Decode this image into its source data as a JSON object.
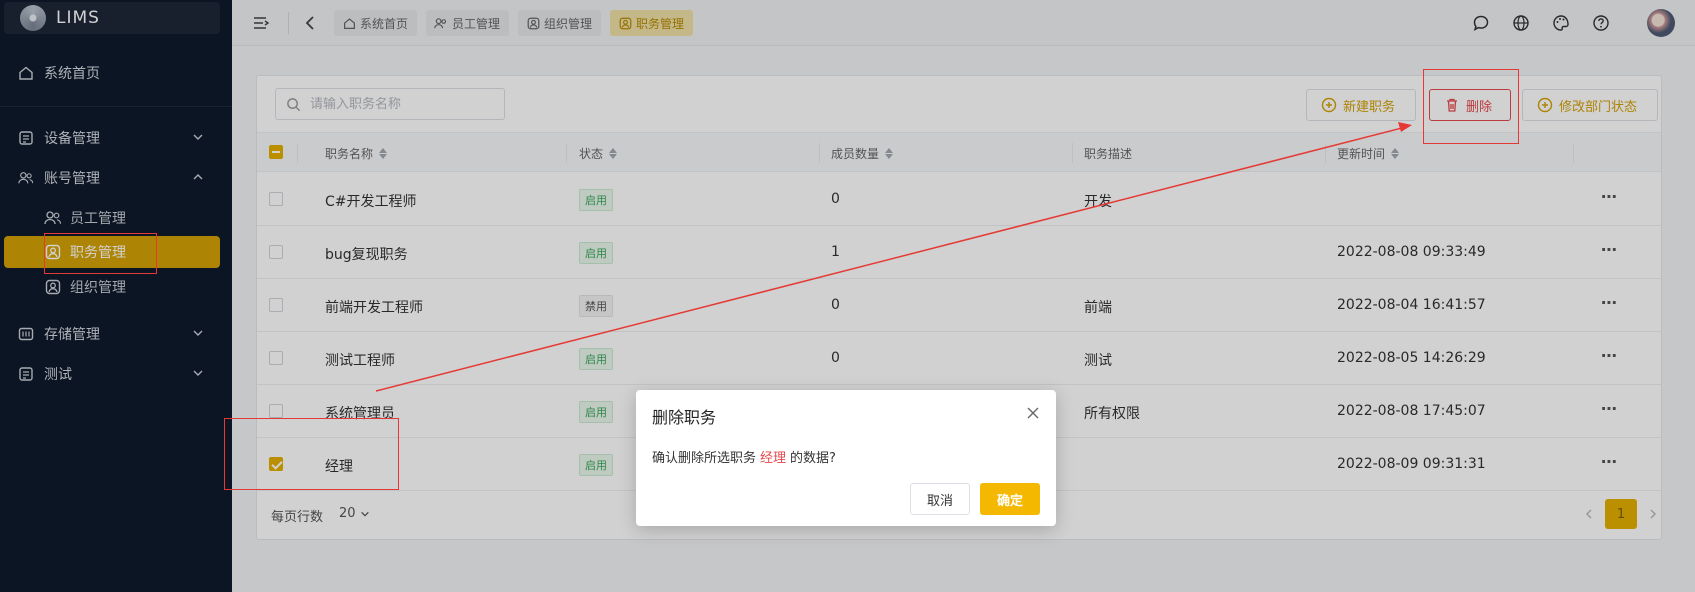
{
  "app": {
    "name": "LIMS"
  },
  "sidebar": {
    "home": "系统首页",
    "groups": [
      {
        "label": "设备管理",
        "icon": "equipment-icon",
        "expanded": false
      },
      {
        "label": "账号管理",
        "icon": "users-icon",
        "expanded": true
      },
      {
        "label": "存储管理",
        "icon": "storage-icon",
        "expanded": false
      },
      {
        "label": "测试",
        "icon": "test-icon",
        "expanded": false
      }
    ],
    "account_children": [
      {
        "label": "员工管理",
        "icon": "users-icon"
      },
      {
        "label": "职务管理",
        "icon": "position-icon",
        "active": true
      },
      {
        "label": "组织管理",
        "icon": "org-icon"
      }
    ]
  },
  "header": {
    "tabs": [
      {
        "label": "系统首页",
        "icon": "home-icon"
      },
      {
        "label": "员工管理",
        "icon": "users-icon"
      },
      {
        "label": "组织管理",
        "icon": "org-icon"
      },
      {
        "label": "职务管理",
        "icon": "position-icon",
        "active": true
      }
    ],
    "icons": [
      "chat-icon",
      "globe-icon",
      "palette-icon",
      "help-icon"
    ]
  },
  "toolbar": {
    "search_placeholder": "请输入职务名称",
    "new_label": "新建职务",
    "delete_label": "删除",
    "edit_status_label": "修改部门状态"
  },
  "table": {
    "columns": [
      "职务名称",
      "状态",
      "成员数量",
      "职务描述",
      "更新时间"
    ],
    "rows": [
      {
        "name": "C#开发工程师",
        "status": "启用",
        "members": "0",
        "desc": "开发",
        "updated": "",
        "checked": false
      },
      {
        "name": "bug复现职务",
        "status": "启用",
        "members": "1",
        "desc": "",
        "updated": "2022-08-08 09:33:49",
        "checked": false
      },
      {
        "name": "前端开发工程师",
        "status": "禁用",
        "members": "0",
        "desc": "前端",
        "updated": "2022-08-04 16:41:57",
        "checked": false
      },
      {
        "name": "测试工程师",
        "status": "启用",
        "members": "0",
        "desc": "测试",
        "updated": "2022-08-05 14:26:29",
        "checked": false
      },
      {
        "name": "系统管理员",
        "status": "启用",
        "members": "",
        "desc": "所有权限",
        "updated": "2022-08-08 17:45:07",
        "checked": false
      },
      {
        "name": "经理",
        "status": "启用",
        "members": "",
        "desc": "",
        "updated": "2022-08-09 09:31:31",
        "checked": true
      }
    ],
    "more": "⋯"
  },
  "footer": {
    "rows_per_page_label": "每页行数",
    "page_size": "20",
    "current_page": "1"
  },
  "dialog": {
    "title": "删除职务",
    "msg_prefix": "确认删除所选职务",
    "msg_target": "经理",
    "msg_suffix": "的数据?",
    "cancel": "取消",
    "confirm": "确定"
  },
  "colors": {
    "accent": "#e5b000",
    "sidebar_bg": "#0f1a2b",
    "danger": "#e5484d"
  }
}
